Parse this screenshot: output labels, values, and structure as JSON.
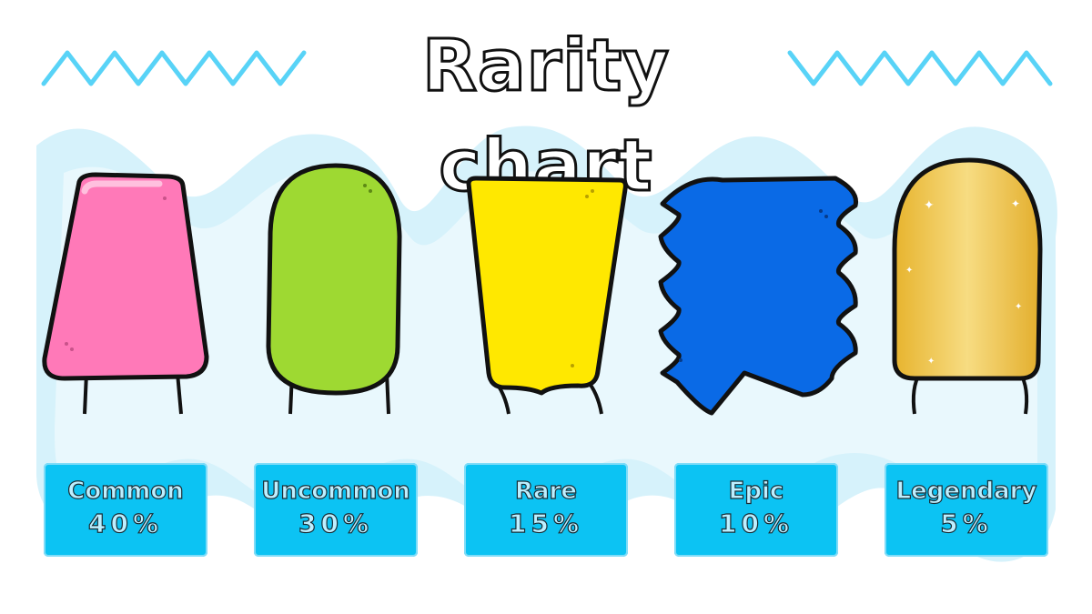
{
  "title": "Rarity chart",
  "colors": {
    "background_wave": "#d6f2fb",
    "zigzag": "#58d3f7",
    "card": "#0cc3f3",
    "outline": "#111111"
  },
  "rarities": [
    {
      "name": "Common",
      "chance": "40%",
      "color": "#ff79b8",
      "shape": "trapezoid-popsicle"
    },
    {
      "name": "Uncommon",
      "chance": "30%",
      "color": "#9ed932",
      "shape": "rounded-popsicle"
    },
    {
      "name": "Rare",
      "chance": "15%",
      "color": "#ffe800",
      "shape": "tapered-popsicle"
    },
    {
      "name": "Epic",
      "chance": "10%",
      "color": "#0a6ae6",
      "shape": "zigzag-popsicle"
    },
    {
      "name": "Legendary",
      "chance": "5%",
      "color": "#f0c64d",
      "shape": "golden-dome-popsicle"
    }
  ]
}
